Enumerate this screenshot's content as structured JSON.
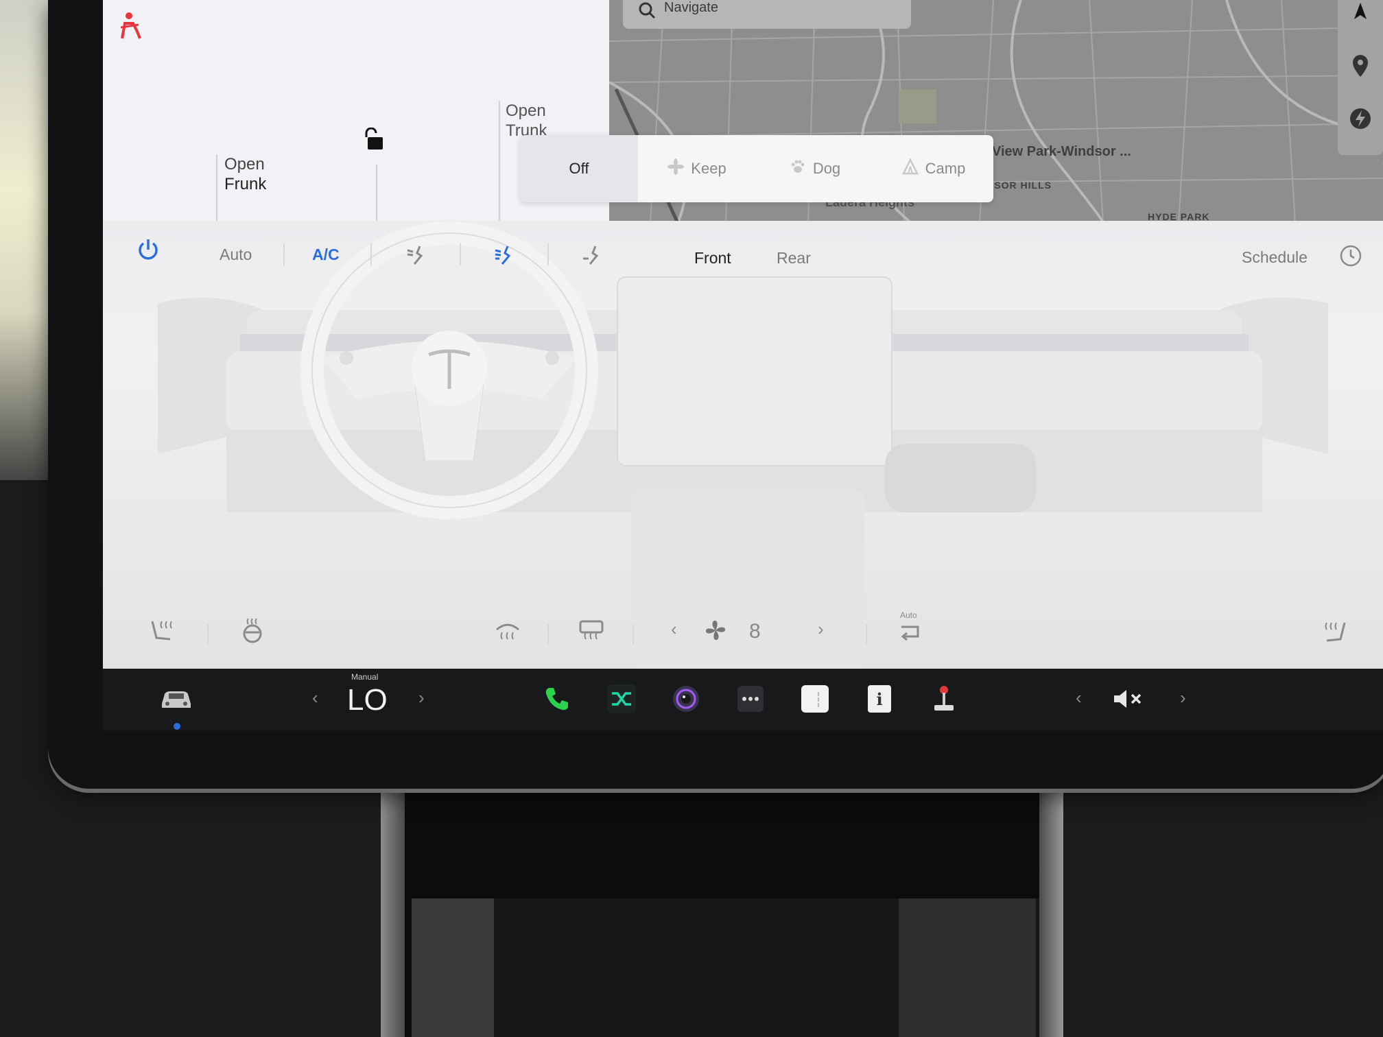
{
  "status": {
    "seatbelt_icon": "seatbelt-warning-icon",
    "lock_icon": "unlocked-icon"
  },
  "car_panel": {
    "open_frunk": [
      "Open",
      "Frunk"
    ],
    "open_trunk": [
      "Open",
      "Trunk"
    ]
  },
  "map": {
    "search_placeholder": "Navigate",
    "labels": [
      "View Park-Windsor ...",
      "WINDSOR HILLS",
      "Ladera Heights",
      "HYDE PARK"
    ]
  },
  "climate_mode": {
    "options": [
      "Off",
      "Keep",
      "Dog",
      "Camp"
    ],
    "selected": "Off"
  },
  "climate": {
    "auto_label": "Auto",
    "ac_label": "A/C",
    "front_label": "Front",
    "rear_label": "Rear",
    "schedule_label": "Schedule",
    "fan_speed": "8",
    "defrost_auto_label": "Auto",
    "accent_color": "#2a6de0"
  },
  "taskbar": {
    "temp_mode_label": "Manual",
    "temperature": "LO",
    "apps": [
      "phone-icon",
      "shuffle-icon",
      "camera-icon",
      "more-icon",
      "calendar-icon",
      "manual-icon",
      "joystick-icon"
    ],
    "volume_icon": "volume-muted-icon"
  }
}
